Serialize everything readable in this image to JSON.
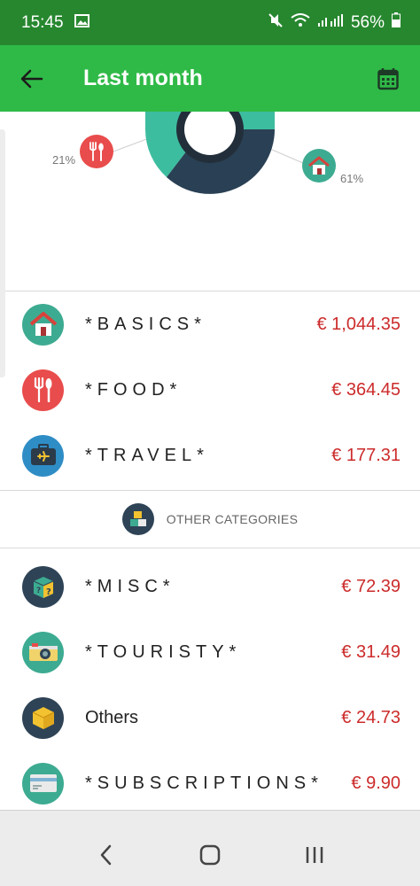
{
  "status": {
    "time": "15:45",
    "battery": "56%"
  },
  "appbar": {
    "title": "Last month"
  },
  "chart": {
    "left_pct": "21%",
    "right_pct": "61%",
    "colors": {
      "donut_teal": "#3dbd9f",
      "donut_dark": "#2a4054",
      "food": "#e94c4c",
      "home": "#3dab91"
    }
  },
  "main_categories": [
    {
      "name": "*BASICS*",
      "amount": "€ 1,044.35",
      "icon": "house-icon",
      "color": "#3dab91"
    },
    {
      "name": "*FOOD*",
      "amount": "€ 364.45",
      "icon": "fork-spoon-icon",
      "color": "#e94c4c"
    },
    {
      "name": "*TRAVEL*",
      "amount": "€ 177.31",
      "icon": "suitcase-plane-icon",
      "color": "#2f8dc6"
    }
  ],
  "other_header": {
    "label": "OTHER CATEGORIES",
    "icon": "cubes-icon"
  },
  "other_categories": [
    {
      "name": "*MISC*",
      "amount": "€ 72.39",
      "icon": "mystery-box-icon",
      "color": "#2e4356"
    },
    {
      "name": "*TOURISTY*",
      "amount": "€ 31.49",
      "icon": "camera-icon",
      "color": "#3dab91"
    },
    {
      "name": "Others",
      "amount": "€ 24.73",
      "icon": "package-icon",
      "color": "#2e4356"
    },
    {
      "name": "*SUBSCRIPTIONS*",
      "amount": "€ 9.90",
      "icon": "card-icon",
      "color": "#3dab91"
    }
  ]
}
